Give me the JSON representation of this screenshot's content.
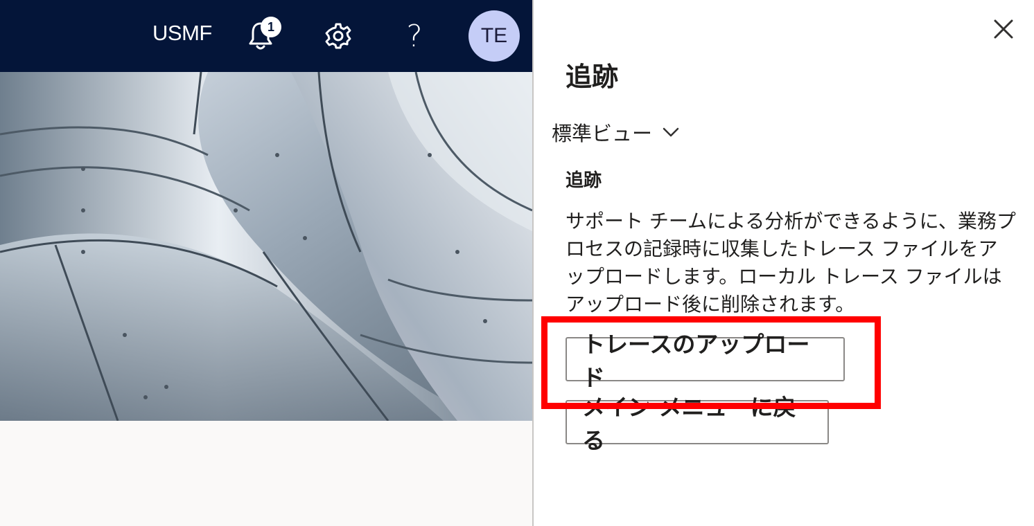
{
  "topbar": {
    "company": "USMF",
    "notification_count": "1",
    "avatar_initials": "TE",
    "help_glyph": "?",
    "icons": [
      "bell-icon",
      "gear-icon",
      "help-icon"
    ],
    "background_color": "#041539"
  },
  "panel": {
    "title": "追跡",
    "view_selector": "標準ビュー",
    "section_title": "追跡",
    "description": "サポート チームによる分析ができるように、業務プロセスの記録時に収集したトレース ファイルをアップロードします。ローカル トレース ファイルはアップロード後に削除されます。",
    "upload_button": "トレースのアップロード",
    "back_button": "メイン メニューに戻る"
  },
  "colors": {
    "highlight": "#ff0000",
    "avatar": "#c5cdf7"
  }
}
